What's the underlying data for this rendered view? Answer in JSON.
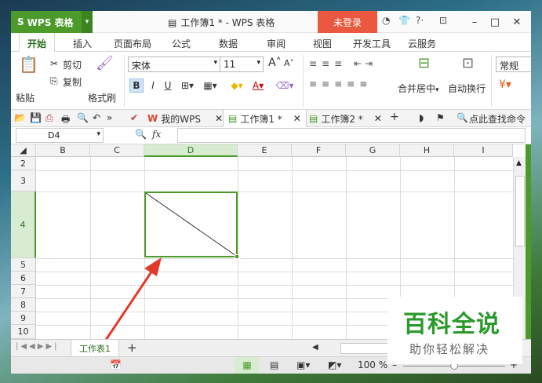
{
  "app": {
    "logo": "WPS 表格",
    "doc_title": "工作簿1 * - WPS 表格",
    "login": "未登录",
    "brand_color": "#4c9a2a",
    "accent_color": "#e9583f"
  },
  "title_icons": [
    "skin-icon",
    "shirt-icon",
    "help-icon",
    "toolbar-icon"
  ],
  "menu": [
    "开始",
    "插入",
    "页面布局",
    "公式",
    "数据",
    "审阅",
    "视图",
    "开发工具",
    "云服务"
  ],
  "ribbon": {
    "paste": "粘贴",
    "cut": "剪切",
    "copy": "复制",
    "format_painter": "格式刷",
    "font": "宋体",
    "font_size": "11",
    "bold": "B",
    "italic": "I",
    "underline": "U",
    "merge": "合并居中",
    "wrap": "自动换行",
    "number_format": "常规"
  },
  "quickbar": {
    "mywps": "我的WPS",
    "tab1": "工作簿1 *",
    "tab2": "工作簿2 *",
    "search": "点此查找命令"
  },
  "formula": {
    "name_box": "D4",
    "fx": "fx"
  },
  "columns": [
    "B",
    "C",
    "D",
    "E",
    "F",
    "G",
    "H",
    "I"
  ],
  "rows": [
    "2",
    "3",
    "4",
    "5",
    "6",
    "7",
    "8",
    "9",
    "10"
  ],
  "selected": {
    "column": "D",
    "row": "4"
  },
  "sheet": {
    "tab": "工作表1"
  },
  "status": {
    "zoom": "100 %"
  },
  "watermark": {
    "title": "百科全说",
    "subtitle": "助你轻松解决"
  }
}
